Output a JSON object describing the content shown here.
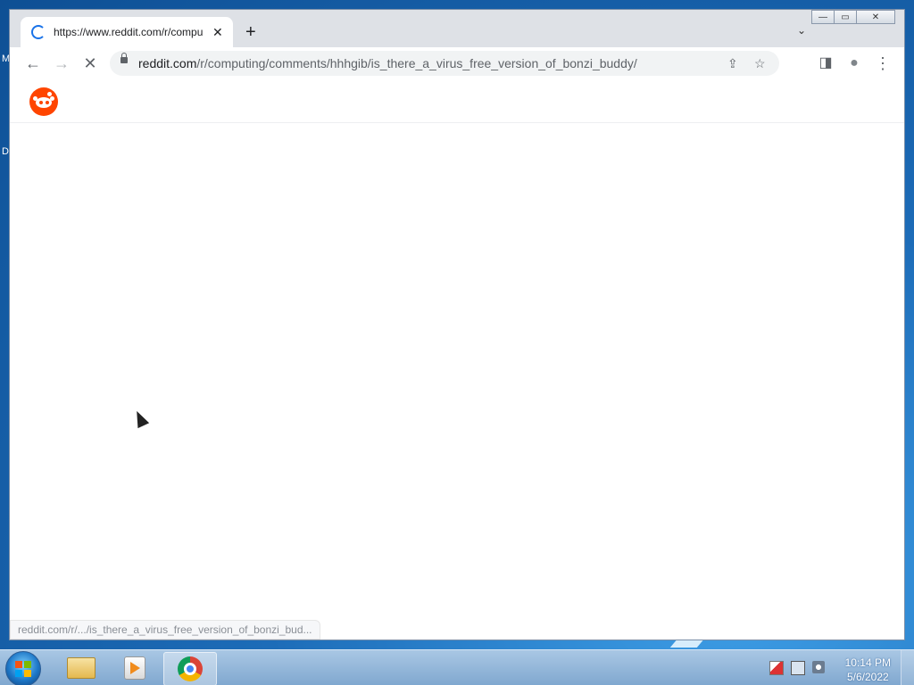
{
  "desktop": {
    "edge_letters": [
      "M",
      "D"
    ]
  },
  "window": {
    "minimize_icon": "minimize-icon",
    "maximize_icon": "maximize-icon",
    "close_icon": "close-icon",
    "minimize_glyph": "—",
    "maximize_glyph": "▭",
    "close_glyph": "✕"
  },
  "tab": {
    "title": "https://www.reddit.com/r/compu",
    "close_glyph": "✕",
    "loading": true
  },
  "new_tab_glyph": "+",
  "tab_list_glyph": "⌄",
  "toolbar": {
    "back_glyph": "←",
    "forward_glyph": "→",
    "stop_glyph": "✕",
    "share_glyph": "⇪",
    "star_glyph": "☆",
    "sidepanel_glyph": "◨",
    "profile_glyph": "●",
    "menu_glyph": "⋮"
  },
  "omnibox": {
    "host": "reddit.com",
    "path": "/r/computing/comments/hhhgib/is_there_a_virus_free_version_of_bonzi_buddy/"
  },
  "status_bar": {
    "text": "reddit.com/r/.../is_there_a_virus_free_version_of_bonzi_bud..."
  },
  "taskbar": {
    "apps": [
      "windows-explorer",
      "windows-media-player",
      "google-chrome"
    ],
    "clock_time": "10:14 PM",
    "clock_date": "5/6/2022"
  },
  "colors": {
    "reddit_orange": "#ff4500",
    "chrome_blue": "#1a73e8"
  }
}
